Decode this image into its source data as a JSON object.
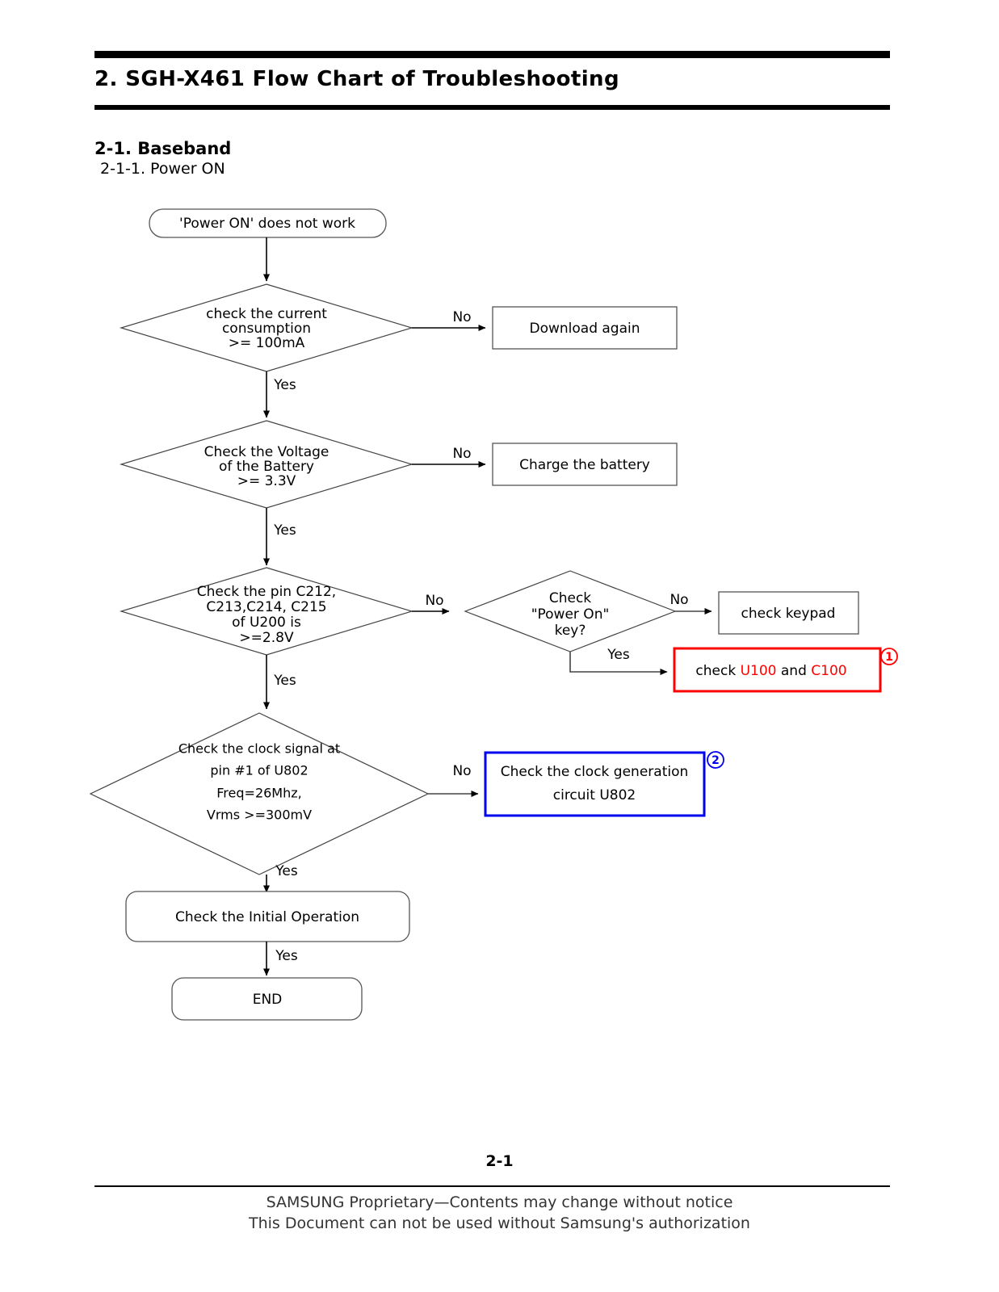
{
  "document": {
    "title": "2. SGH-X461 Flow Chart of Troubleshooting",
    "section": "2-1. Baseband",
    "subsection": "2-1-1. Power ON",
    "page_number": "2-1"
  },
  "footer": {
    "line1": "SAMSUNG Proprietary—Contents may change without notice",
    "line2": "This Document can not be used without Samsung's authorization"
  },
  "flow": {
    "start": {
      "label": "'Power ON' does not work"
    },
    "decision_current": {
      "line1": "check the current",
      "line2": "consumption",
      "line3": ">=  100mA",
      "yes": "Yes",
      "no": "No"
    },
    "action_download": {
      "label": "Download again"
    },
    "decision_voltage": {
      "line1": "Check the Voltage",
      "line2": "of the Battery",
      "line3": ">=  3.3V",
      "yes": "Yes",
      "no": "No"
    },
    "action_charge": {
      "label": "Charge the battery"
    },
    "decision_pins": {
      "line1": "Check the pin C212,",
      "line2": "C213,C214, C215",
      "line3": "of U200 is",
      "line4": ">=2.8V",
      "yes": "Yes",
      "no": "No"
    },
    "decision_powerkey": {
      "line1": "Check",
      "line2": "\"Power On\"",
      "line3": "key?",
      "yes": "Yes",
      "no": "No"
    },
    "action_keypad": {
      "label": "check keypad"
    },
    "action_u100": {
      "prefix": "check ",
      "part1": "U100",
      "middle": " and ",
      "part2": "C100",
      "marker": "1",
      "border_color": "#ff0000"
    },
    "decision_clock": {
      "line1": "Check the clock signal at",
      "line2": "pin #1 of U802",
      "line3": "Freq=26Mhz,",
      "line4": "Vrms >=300mV",
      "yes": "Yes",
      "no": "No"
    },
    "action_clockgen": {
      "line1": "Check the clock generation",
      "line2": "circuit U802",
      "marker": "2",
      "border_color": "#0000ee"
    },
    "action_initial": {
      "label": "Check the Initial Operation",
      "yes": "Yes"
    },
    "end": {
      "label": "END"
    }
  }
}
